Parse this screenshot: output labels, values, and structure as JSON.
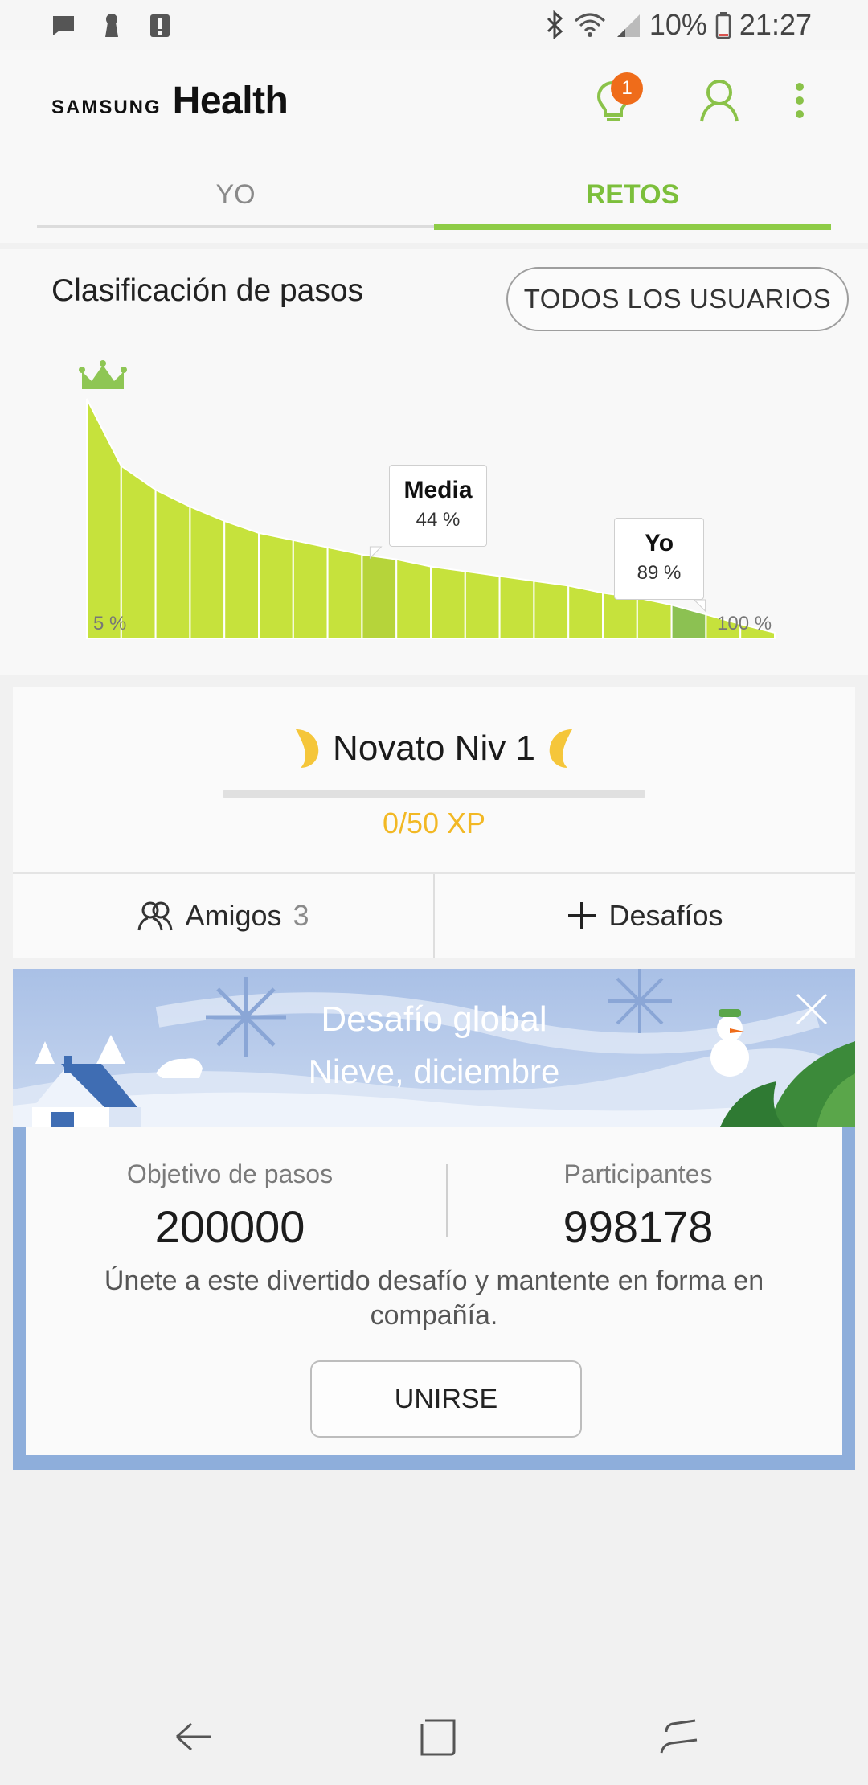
{
  "status_bar": {
    "battery": "10%",
    "time": "21:27",
    "left_icons": [
      "message-icon",
      "keyhole-icon",
      "alert-icon"
    ],
    "right_icons": [
      "bluetooth-icon",
      "wifi-icon",
      "signal-icon",
      "battery-icon"
    ]
  },
  "header": {
    "logo_brand": "SAMSUNG",
    "logo_product": "Health",
    "notification_count": "1",
    "actions": [
      "lightbulb-icon",
      "profile-icon",
      "more-vert-icon"
    ]
  },
  "tabs": [
    {
      "label": "YO",
      "active": false
    },
    {
      "label": "RETOS",
      "active": true
    }
  ],
  "ranking": {
    "title": "Clasificación de pasos",
    "filter_button": "TODOS LOS USUARIOS",
    "average_label": "Media",
    "average_value": "44 %",
    "me_label": "Yo",
    "me_value": "89 %",
    "low_label": "5 %",
    "high_label": "100 %",
    "accent_color": "#c6e23c",
    "average_color": "#b6d43a",
    "me_color": "#8cc152"
  },
  "chart_data": {
    "type": "bar",
    "description_units": "relative step-count height per percentile bucket",
    "categories": [
      "1",
      "2",
      "3",
      "4",
      "5",
      "6",
      "7",
      "8",
      "9",
      "10",
      "11",
      "12",
      "13",
      "14",
      "15",
      "16",
      "17",
      "18",
      "19",
      "20"
    ],
    "values": [
      100,
      72,
      62,
      55,
      49,
      44,
      41,
      38,
      35,
      33,
      30,
      28,
      26,
      24,
      22,
      19,
      17,
      14,
      10,
      6
    ],
    "highlight": {
      "average_index": 8,
      "me_index": 17
    },
    "xlabel_left": "5 %",
    "xlabel_right": "100 %"
  },
  "level": {
    "name": "Novato Niv 1",
    "xp_text": "0/50 XP",
    "xp_progress": 0
  },
  "social": {
    "friends_label": "Amigos",
    "friends_count": "3",
    "challenges_label": "Desafíos"
  },
  "challenge": {
    "banner_title": "Desafío global",
    "banner_subtitle": "Nieve, diciembre",
    "goal_label": "Objetivo de pasos",
    "goal_value": "200000",
    "participants_label": "Participantes",
    "participants_value": "998178",
    "description": "Únete a este divertido desafío y mantente en forma en compañía.",
    "join_button": "UNIRSE"
  },
  "nav": [
    "back-icon",
    "home-icon",
    "recents-icon"
  ]
}
